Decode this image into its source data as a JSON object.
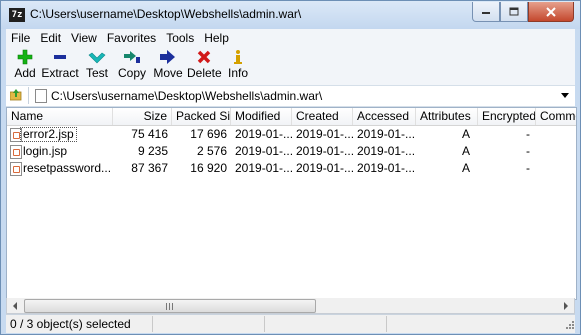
{
  "window": {
    "app_icon_text": "7z",
    "title": "C:\\Users\\username\\Desktop\\Webshells\\admin.war\\"
  },
  "menu": [
    "File",
    "Edit",
    "View",
    "Favorites",
    "Tools",
    "Help"
  ],
  "toolbar": [
    {
      "label": "Add",
      "icon": "plus-icon",
      "color": "#13b313"
    },
    {
      "label": "Extract",
      "icon": "minus-icon",
      "color": "#1c2f9c"
    },
    {
      "label": "Test",
      "icon": "check-icon",
      "color": "#18b7b7"
    },
    {
      "label": "Copy",
      "icon": "copy-arrow-icon",
      "color": "#17876d"
    },
    {
      "label": "Move",
      "icon": "move-arrow-icon",
      "color": "#1c2f9c"
    },
    {
      "label": "Delete",
      "icon": "x-icon",
      "color": "#d11919"
    },
    {
      "label": "Info",
      "icon": "info-icon",
      "color": "#d4a000"
    }
  ],
  "address": {
    "path": "C:\\Users\\username\\Desktop\\Webshells\\admin.war\\"
  },
  "columns": [
    "Name",
    "Size",
    "Packed Si...",
    "Modified",
    "Created",
    "Accessed",
    "Attributes",
    "Encrypted",
    "Commen"
  ],
  "files": [
    {
      "name": "error2.jsp",
      "size": "75 416",
      "packed": "17 696",
      "modified": "2019-01-...",
      "created": "2019-01-...",
      "accessed": "2019-01-...",
      "attributes": "A",
      "encrypted": "-"
    },
    {
      "name": "login.jsp",
      "size": "9 235",
      "packed": "2 576",
      "modified": "2019-01-...",
      "created": "2019-01-...",
      "accessed": "2019-01-...",
      "attributes": "A",
      "encrypted": "-"
    },
    {
      "name": "resetpassword...",
      "size": "87 367",
      "packed": "16 920",
      "modified": "2019-01-...",
      "created": "2019-01-...",
      "accessed": "2019-01-...",
      "attributes": "A",
      "encrypted": "-"
    }
  ],
  "status": {
    "selection": "0 / 3 object(s) selected"
  }
}
